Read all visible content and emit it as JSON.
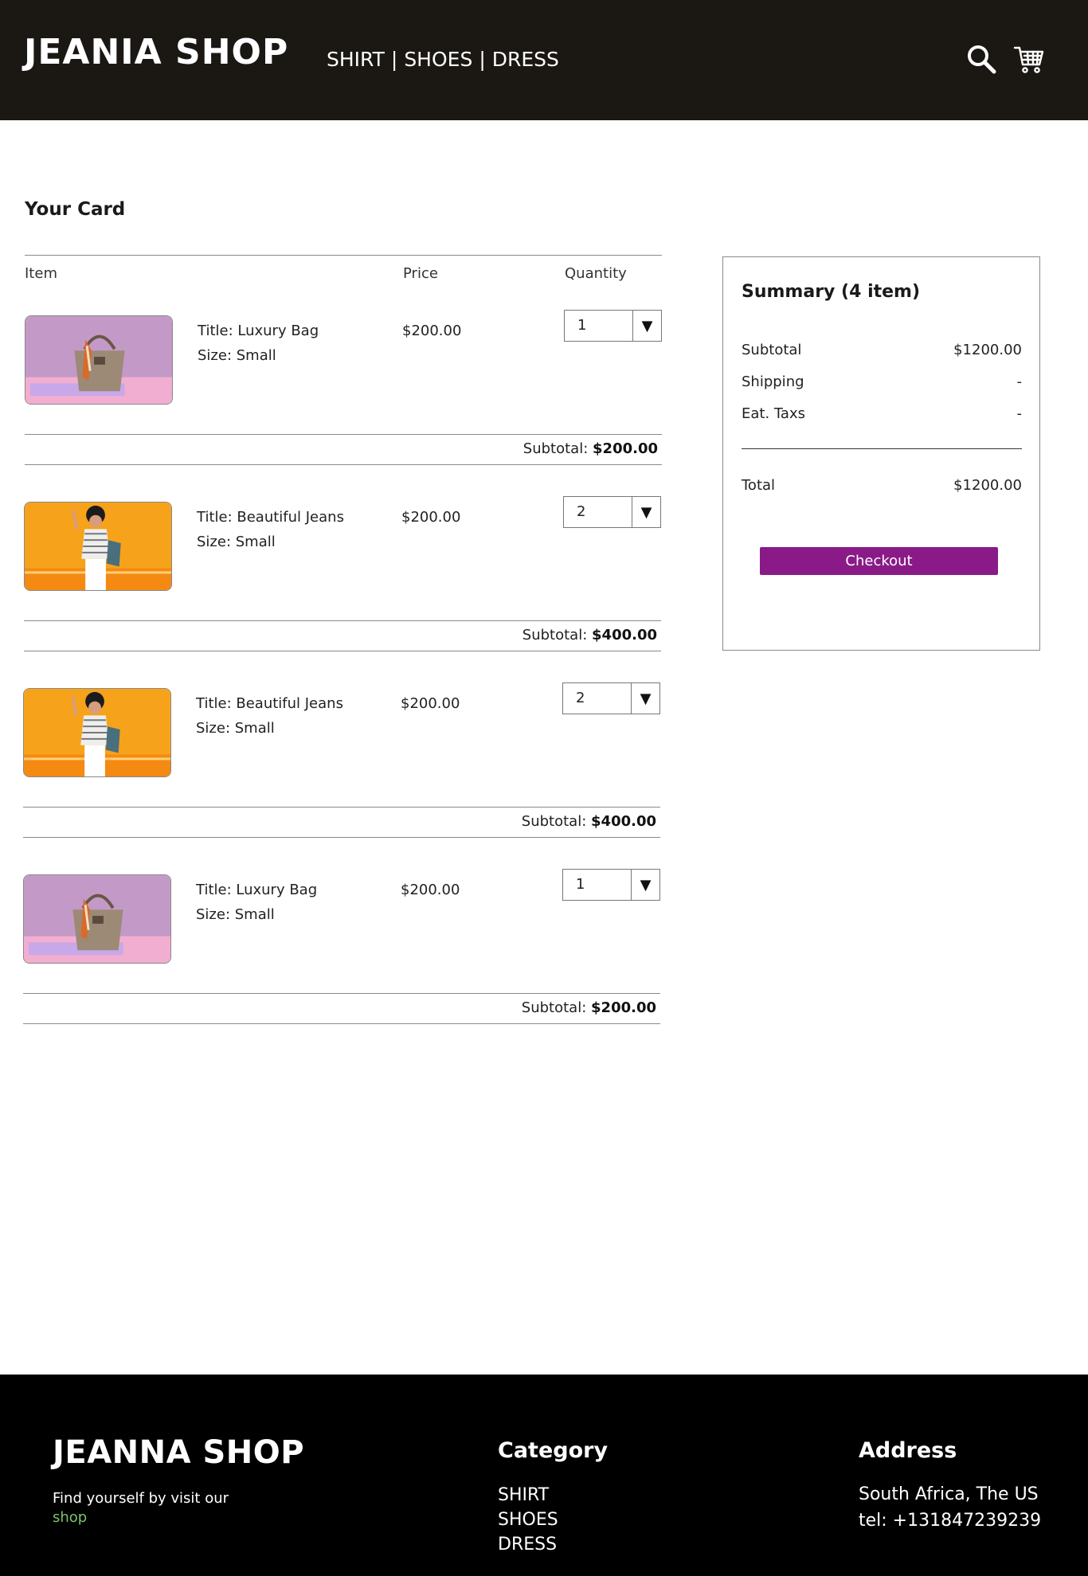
{
  "header": {
    "logo": "JEANIA SHOP",
    "nav": [
      "SHIRT",
      "SHOES",
      "DRESS"
    ],
    "nav_separator": "|",
    "icons": [
      "search-icon",
      "cart-icon"
    ]
  },
  "page_title": "Your Card",
  "table": {
    "col_item": "Item",
    "col_price": "Price",
    "col_quantity": "Quantity"
  },
  "items": [
    {
      "image": "luxury-bag-photo",
      "title": "Title: Luxury Bag",
      "size": "Size: Small",
      "price": "$200.00",
      "quantity": "1",
      "subtotal_label": "Subtotal:",
      "subtotal_value": "$200.00"
    },
    {
      "image": "beautiful-jeans-photo",
      "title": "Title: Beautiful Jeans",
      "size": "Size: Small",
      "price": "$200.00",
      "quantity": "2",
      "subtotal_label": "Subtotal:",
      "subtotal_value": "$400.00"
    },
    {
      "image": "beautiful-jeans-photo",
      "title": "Title: Beautiful Jeans",
      "size": "Size: Small",
      "price": "$200.00",
      "quantity": "2",
      "subtotal_label": "Subtotal:",
      "subtotal_value": "$400.00"
    },
    {
      "image": "luxury-bag-photo",
      "title": "Title: Luxury Bag",
      "size": "Size: Small",
      "price": "$200.00",
      "quantity": "1",
      "subtotal_label": "Subtotal:",
      "subtotal_value": "$200.00"
    }
  ],
  "summary": {
    "title": "Summary (4 item)",
    "subtotal_label": "Subtotal",
    "subtotal_value": "$1200.00",
    "shipping_label": "Shipping",
    "shipping_value": "-",
    "taxes_label": "Eat. Taxs",
    "taxes_value": "-",
    "total_label": "Total",
    "total_value": "$1200.00",
    "checkout_label": "Checkout"
  },
  "footer": {
    "logo": "JEANNA SHOP",
    "tagline": "Find yourself by visit our",
    "link": "shop",
    "category_heading": "Category",
    "categories": [
      "SHIRT",
      "SHOES",
      "DRESS"
    ],
    "address_heading": "Address",
    "address": "South Africa, The US",
    "phone": "tel: +131847239239"
  },
  "colors": {
    "header_bg": "#1b1814",
    "footer_bg": "#000000",
    "checkout_bg": "#8a1a88",
    "footer_link": "#7bc26b"
  }
}
